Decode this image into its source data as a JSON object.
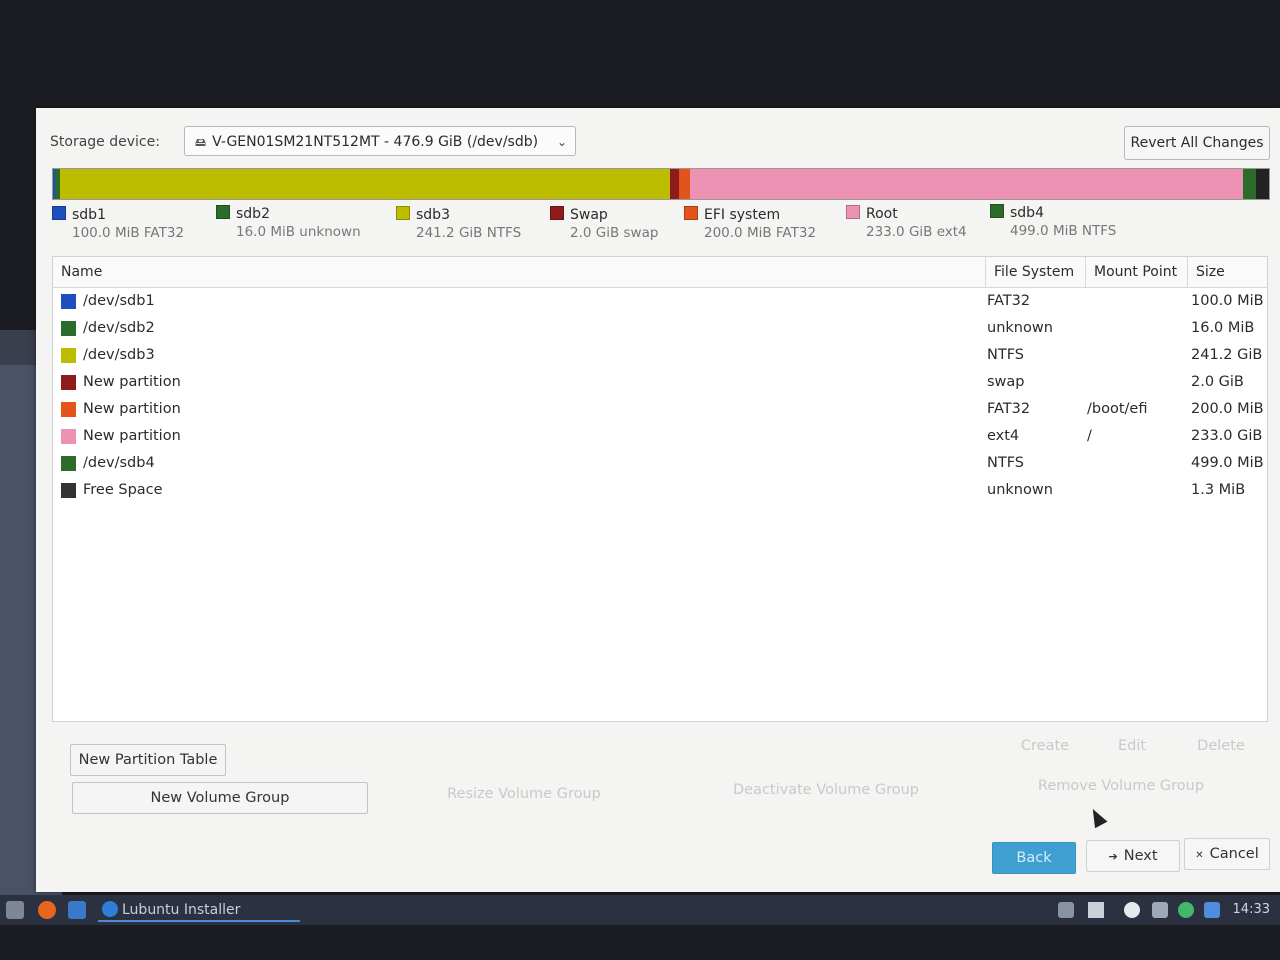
{
  "storage": {
    "label": "Storage device:",
    "device": "V-GEN01SM21NT512MT - 476.9 GiB (/dev/sdb)",
    "revert_label": "Revert All Changes"
  },
  "bar_segments": [
    {
      "color": "#1f4fbf",
      "share": 0.2
    },
    {
      "color": "#2d6b2a",
      "share": 0.4
    },
    {
      "color": "#bdbd00",
      "share": 50.1
    },
    {
      "color": "#8e1c1c",
      "share": 0.8
    },
    {
      "color": "#e3531a",
      "share": 0.9
    },
    {
      "color": "#ee92b4",
      "share": 45.5
    },
    {
      "color": "#2d6b2a",
      "share": 1.0
    },
    {
      "color": "#222222",
      "share": 1.1
    }
  ],
  "legend": [
    {
      "name": "sdb1",
      "detail": "100.0 MiB  FAT32",
      "color": "#1f4fbf"
    },
    {
      "name": "sdb2",
      "detail": "16.0 MiB  unknown",
      "color": "#2d6b2a"
    },
    {
      "name": "sdb3",
      "detail": "241.2 GiB  NTFS",
      "color": "#bdbd00"
    },
    {
      "name": "Swap",
      "detail": "2.0 GiB  swap",
      "color": "#8e1c1c"
    },
    {
      "name": "EFI system",
      "detail": "200.0 MiB  FAT32",
      "color": "#e3531a"
    },
    {
      "name": "Root",
      "detail": "233.0 GiB  ext4",
      "color": "#ee92b4"
    },
    {
      "name": "sdb4",
      "detail": "499.0 MiB  NTFS",
      "color": "#2d6b2a"
    }
  ],
  "columns": {
    "name": "Name",
    "fs": "File System",
    "mount": "Mount Point",
    "size": "Size"
  },
  "partitions": [
    {
      "name": "/dev/sdb1",
      "fs": "FAT32",
      "mount": "",
      "size": "100.0 MiB",
      "color": "#1f4fbf"
    },
    {
      "name": "/dev/sdb2",
      "fs": "unknown",
      "mount": "",
      "size": "16.0 MiB",
      "color": "#2d6b2a"
    },
    {
      "name": "/dev/sdb3",
      "fs": "NTFS",
      "mount": "",
      "size": "241.2 GiB",
      "color": "#bdbd00"
    },
    {
      "name": "New partition",
      "fs": "swap",
      "mount": "",
      "size": "2.0 GiB",
      "color": "#8e1c1c"
    },
    {
      "name": "New partition",
      "fs": "FAT32",
      "mount": "/boot/efi",
      "size": "200.0 MiB",
      "color": "#e3531a"
    },
    {
      "name": "New partition",
      "fs": "ext4",
      "mount": "/",
      "size": "233.0 GiB",
      "color": "#ee92b4"
    },
    {
      "name": "/dev/sdb4",
      "fs": "NTFS",
      "mount": "",
      "size": "499.0 MiB",
      "color": "#2d6b2a"
    },
    {
      "name": "Free Space",
      "fs": "unknown",
      "mount": "",
      "size": "1.3 MiB",
      "color": "#333333"
    }
  ],
  "actions": {
    "new_partition_table": "New Partition Table",
    "create": "Create",
    "edit": "Edit",
    "delete": "Delete",
    "new_volume_group": "New Volume Group",
    "resize_volume_group": "Resize Volume Group",
    "deactivate_volume_group": "Deactivate Volume Group",
    "remove_volume_group": "Remove Volume Group"
  },
  "nav": {
    "back": "Back",
    "next": "Next",
    "cancel": "Cancel"
  },
  "taskbar": {
    "task": "Lubuntu Installer",
    "clock": "14:33"
  }
}
